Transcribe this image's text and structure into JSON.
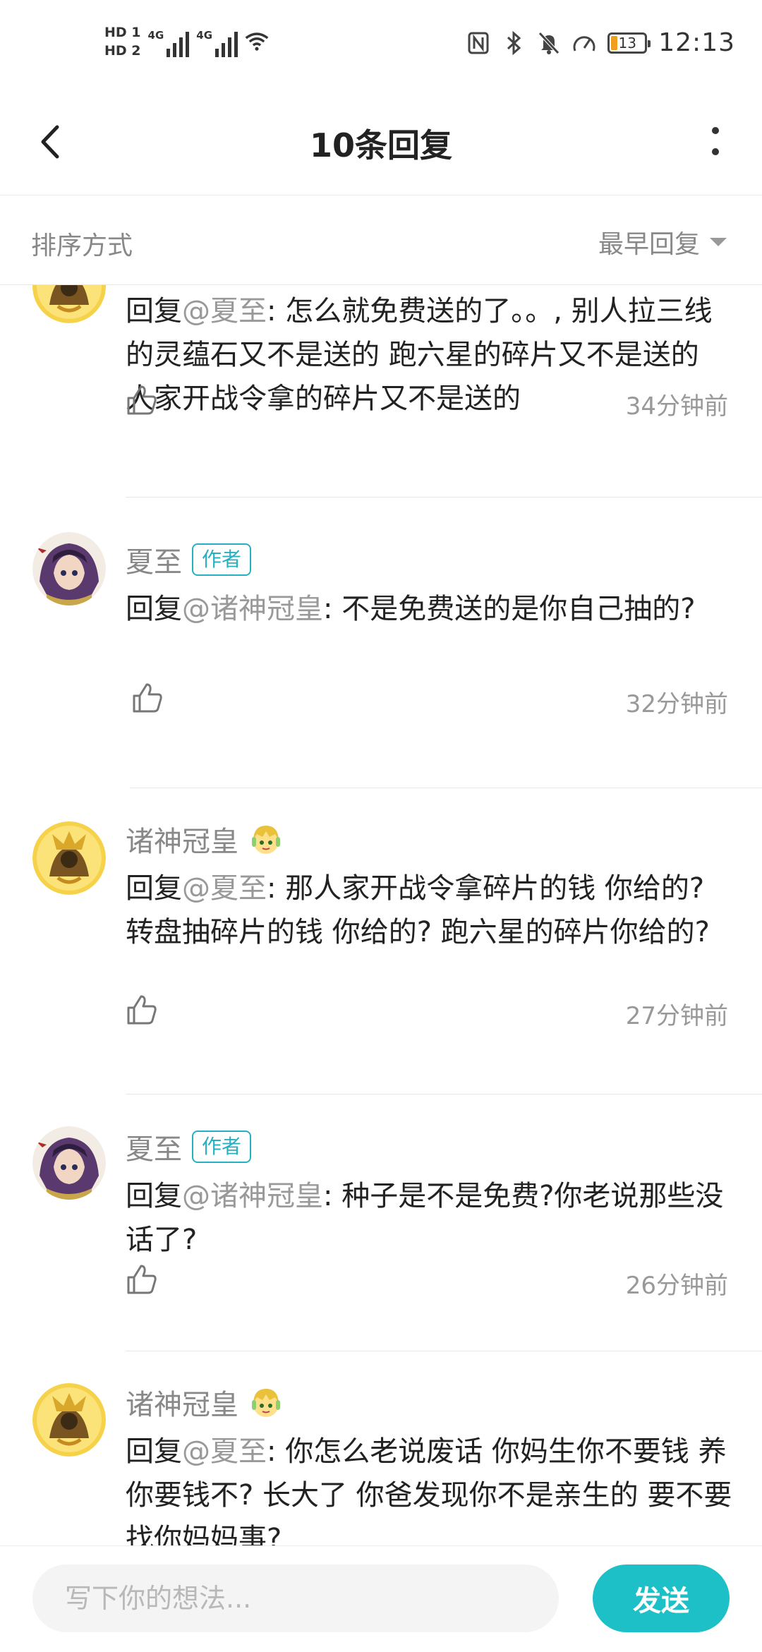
{
  "status_bar": {
    "hd1": "HD 1",
    "hd2": "HD 2",
    "sig1": "4G",
    "sig2": "4G",
    "battery": "13",
    "time": "12:13"
  },
  "header": {
    "title": "10条回复"
  },
  "sort": {
    "label": "排序方式",
    "selected": "最早回复"
  },
  "replies": [
    {
      "name": "",
      "prefix": "回复",
      "mention": "@夏至",
      "body": ":  怎么就免费送的了。。,  别人拉三线的灵蕴石又不是送的  跑六星的碎片又不是送的  人家开战令拿的碎片又不是送的",
      "time": "34分钟前",
      "avatar": "gold-warrior-avatar"
    },
    {
      "name": "夏至",
      "badge": "作者",
      "prefix": "回复",
      "mention": "@诸神冠皇",
      "body": ":  不是免费送的是你自己抽的?",
      "time": "32分钟前",
      "avatar": "anime-girl-avatar"
    },
    {
      "name": "诸神冠皇",
      "prefix": "回复",
      "mention": "@夏至",
      "body": ":  那人家开战令拿碎片的钱 你给的?  转盘抽碎片的钱 你给的?  跑六星的碎片你给的?",
      "time": "27分钟前",
      "avatar": "gold-warrior-avatar"
    },
    {
      "name": "夏至",
      "badge": "作者",
      "prefix": "回复",
      "mention": "@诸神冠皇",
      "body": ":  种子是不是免费?你老说那些没话了?",
      "time": "26分钟前",
      "avatar": "anime-girl-avatar"
    },
    {
      "name": "诸神冠皇",
      "prefix": "回复",
      "mention": "@夏至",
      "body": ":  你怎么老说废话  你妈生你不要钱 养你要钱不?  长大了 你爸发现你不是亲生的  要不要找你妈妈事?",
      "time": "",
      "avatar": "gold-warrior-avatar"
    }
  ],
  "compose": {
    "placeholder": "写下你的想法...",
    "send_label": "发送"
  }
}
